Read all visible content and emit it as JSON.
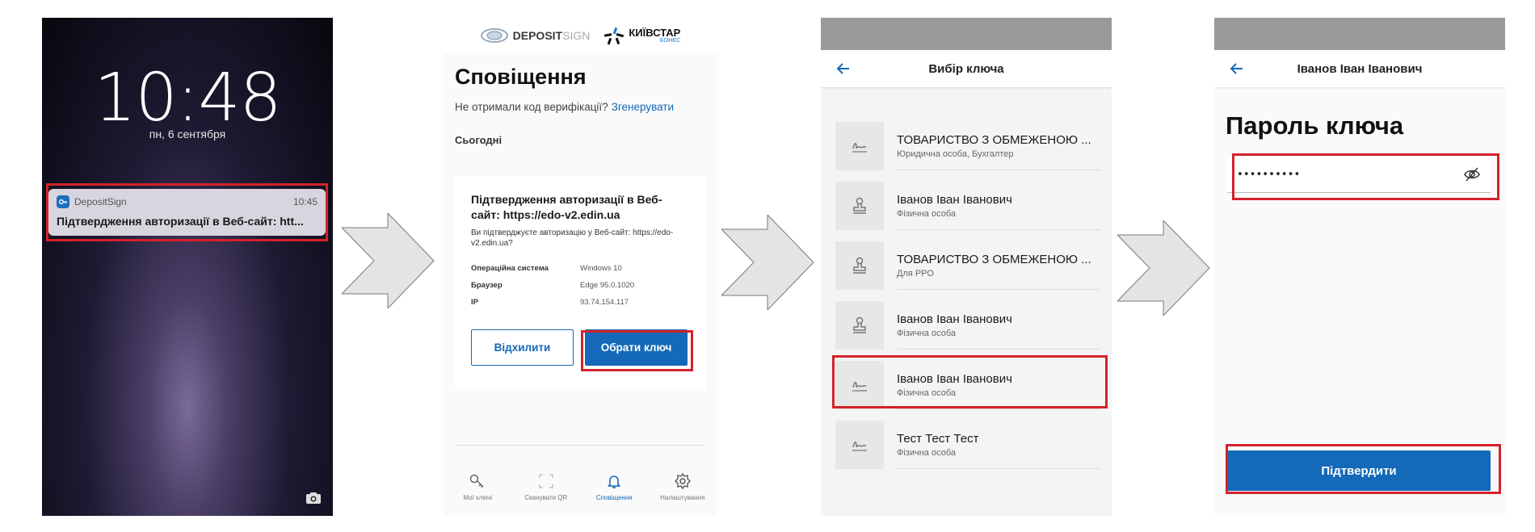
{
  "lock_screen": {
    "time": "10:48",
    "date": "пн, 6 сентября",
    "notification": {
      "app_name": "DepositSign",
      "time": "10:45",
      "text": "Підтвердження авторизації в Веб-сайт: htt..."
    },
    "camera_icon": "camera-icon"
  },
  "notifications_screen": {
    "brand_1": {
      "bold": "DEPOSIT",
      "light": "SIGN"
    },
    "brand_2": {
      "name": "КИЇВСТАР",
      "sub": "БІЗНЕС"
    },
    "title": "Сповіщення",
    "resend_text": "Не отримали код верифікації?",
    "resend_link": "Згенерувати",
    "section_today": "Сьогодні",
    "card": {
      "title": "Підтвердження авторизації в Веб-сайт: https://edo-v2.edin.ua",
      "subtitle": "Ви підтверджуєте авторизацію у Веб-сайт: https://edo-v2.edin.ua?",
      "rows": [
        {
          "key": "Операційна система",
          "value": "Windows 10"
        },
        {
          "key": "Браузер",
          "value": "Edge 95.0.1020"
        },
        {
          "key": "IP",
          "value": "93.74.154.117"
        }
      ],
      "decline_label": "Відхилити",
      "choose_key_label": "Обрати ключ"
    },
    "nav": [
      {
        "label": "Мої ключі",
        "icon": "key-icon"
      },
      {
        "label": "Сканувати QR",
        "icon": "qr-scan-icon"
      },
      {
        "label": "Сповіщення",
        "icon": "bell-icon",
        "active": true
      },
      {
        "label": "Налаштування",
        "icon": "gear-icon"
      }
    ]
  },
  "key_select_screen": {
    "title": "Вибір ключа",
    "keys": [
      {
        "name": "ТОВАРИСТВО З ОБМЕЖЕНОЮ ...",
        "type": "Юридична особа, Бухгалтер",
        "icon": "signature-icon"
      },
      {
        "name": "Іванов Іван Іванович",
        "type": "Фізична особа",
        "icon": "stamp-icon"
      },
      {
        "name": "ТОВАРИСТВО З ОБМЕЖЕНОЮ ...",
        "type": "Для РРО",
        "icon": "stamp-icon"
      },
      {
        "name": "Іванов Іван Іванович",
        "type": "Фізична особа",
        "icon": "stamp-icon"
      },
      {
        "name": "Іванов Іван Іванович",
        "type": "Фізична особа",
        "icon": "signature-icon"
      },
      {
        "name": "Тест Тест Тест",
        "type": "Фізична особа",
        "icon": "signature-icon"
      }
    ]
  },
  "password_screen": {
    "header_title": "Іванов Іван Іванович",
    "title": "Пароль ключа",
    "password_value": "••••••••••",
    "confirm_label": "Підтвердити"
  },
  "colors": {
    "accent": "#1469b8",
    "highlight": "#d3222a"
  }
}
